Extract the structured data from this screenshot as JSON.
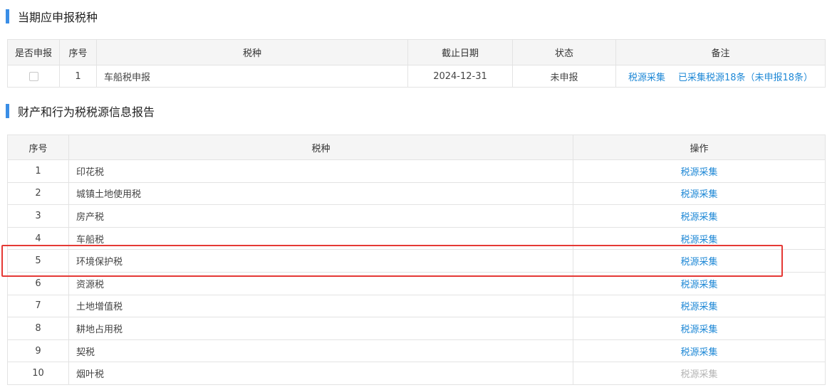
{
  "section1": {
    "title": "当期应申报税种",
    "headers": [
      "是否申报",
      "序号",
      "税种",
      "截止日期",
      "状态",
      "备注"
    ],
    "rows": [
      {
        "index": "1",
        "tax": "车船税申报",
        "deadline": "2024-12-31",
        "status": "未申报",
        "note_link": "税源采集",
        "note_text": "已采集税源18条（未申报18条）"
      }
    ]
  },
  "section2": {
    "title": "财产和行为税税源信息报告",
    "headers": [
      "序号",
      "税种",
      "操作"
    ],
    "rows": [
      {
        "index": "1",
        "tax": "印花税",
        "action": "税源采集"
      },
      {
        "index": "2",
        "tax": "城镇土地使用税",
        "action": "税源采集"
      },
      {
        "index": "3",
        "tax": "房产税",
        "action": "税源采集"
      },
      {
        "index": "4",
        "tax": "车船税",
        "action": "税源采集"
      },
      {
        "index": "5",
        "tax": "环境保护税",
        "action": "税源采集"
      },
      {
        "index": "6",
        "tax": "资源税",
        "action": "税源采集"
      },
      {
        "index": "7",
        "tax": "土地增值税",
        "action": "税源采集"
      },
      {
        "index": "8",
        "tax": "耕地占用税",
        "action": "税源采集"
      },
      {
        "index": "9",
        "tax": "契税",
        "action": "税源采集"
      },
      {
        "index": "10",
        "tax": "烟叶税",
        "action": "税源采集"
      }
    ]
  },
  "colors": {
    "accent_bar": "#3a8ee6",
    "link": "#1e88d6",
    "disabled": "#b5b5b5",
    "highlight": "#e53935"
  }
}
